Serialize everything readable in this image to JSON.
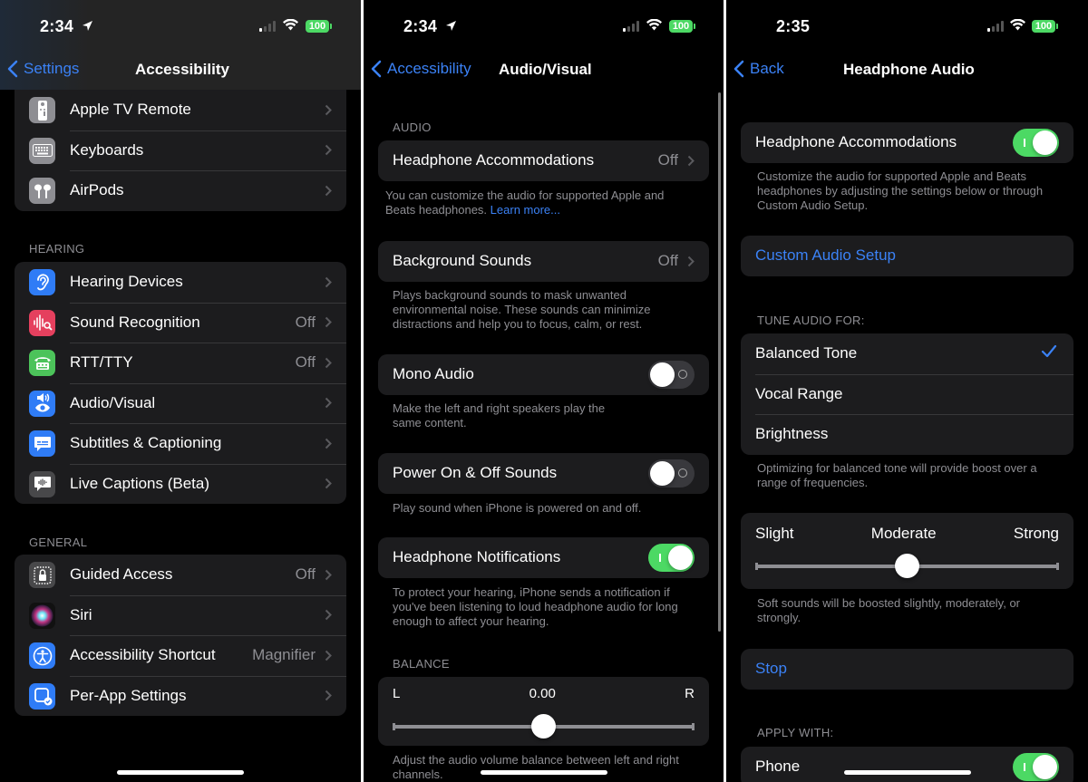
{
  "panels": [
    {
      "status": {
        "time": "2:34",
        "location_arrow": true,
        "battery": "100"
      },
      "nav": {
        "back_label": "Settings",
        "title": "Accessibility"
      },
      "groups": [
        {
          "header": "",
          "items": [
            {
              "label": "Apple TV Remote",
              "value": "",
              "icon": "apple-tv-remote-icon",
              "icon_color": "#8e8e93"
            },
            {
              "label": "Keyboards",
              "value": "",
              "icon": "keyboard-icon",
              "icon_color": "#8e8e93"
            },
            {
              "label": "AirPods",
              "value": "",
              "icon": "airpods-icon",
              "icon_color": "#8e8e93"
            }
          ]
        },
        {
          "header": "HEARING",
          "items": [
            {
              "label": "Hearing Devices",
              "value": "",
              "icon": "ear-icon",
              "icon_color": "#2f7cf6"
            },
            {
              "label": "Sound Recognition",
              "value": "Off",
              "icon": "sound-recognition-icon",
              "icon_color": "#e5405e"
            },
            {
              "label": "RTT/TTY",
              "value": "Off",
              "icon": "tty-phone-icon",
              "icon_color": "#4cc35a"
            },
            {
              "label": "Audio/Visual",
              "value": "",
              "icon": "audio-visual-icon",
              "icon_color": "#2f7cf6"
            },
            {
              "label": "Subtitles & Captioning",
              "value": "",
              "icon": "subtitles-icon",
              "icon_color": "#2f7cf6"
            },
            {
              "label": "Live Captions (Beta)",
              "value": "",
              "icon": "live-captions-icon",
              "icon_color": "#48484a"
            }
          ]
        },
        {
          "header": "GENERAL",
          "items": [
            {
              "label": "Guided Access",
              "value": "Off",
              "icon": "guided-access-lock-icon",
              "icon_color": "#48484a"
            },
            {
              "label": "Siri",
              "value": "",
              "icon": "siri-icon",
              "icon_color": "#222"
            },
            {
              "label": "Accessibility Shortcut",
              "value": "Magnifier",
              "icon": "accessibility-icon",
              "icon_color": "#2f7cf6"
            },
            {
              "label": "Per-App Settings",
              "value": "",
              "icon": "per-app-settings-icon",
              "icon_color": "#2f7cf6"
            }
          ]
        }
      ]
    },
    {
      "status": {
        "time": "2:34",
        "location_arrow": true,
        "battery": "100"
      },
      "nav": {
        "back_label": "Accessibility",
        "title": "Audio/Visual"
      },
      "audio_header": "AUDIO",
      "headphone_accommodations": {
        "label": "Headphone Accommodations",
        "value": "Off"
      },
      "headphone_accommodations_footer": "You can customize the audio for supported Apple and Beats headphones.",
      "learn_more": "Learn more...",
      "background_sounds": {
        "label": "Background Sounds",
        "value": "Off"
      },
      "background_sounds_footer": "Plays background sounds to mask unwanted environmental noise. These sounds can minimize distractions and help you to focus, calm, or rest.",
      "mono_audio": {
        "label": "Mono Audio",
        "on": false
      },
      "mono_audio_footer": "Make the left and right speakers play the same content.",
      "power_sounds": {
        "label": "Power On & Off Sounds",
        "on": false
      },
      "power_sounds_footer": "Play sound when iPhone is powered on and off.",
      "headphone_notifications": {
        "label": "Headphone Notifications",
        "on": true
      },
      "headphone_notifications_footer": "To protect your hearing, iPhone sends a notification if you've been listening to loud headphone audio for long enough to affect your hearing.",
      "balance_header": "BALANCE",
      "balance": {
        "left_label": "L",
        "right_label": "R",
        "value_text": "0.00",
        "value": 0.0,
        "min": -1,
        "max": 1
      },
      "balance_footer": "Adjust the audio volume balance between left and right channels."
    },
    {
      "status": {
        "time": "2:35",
        "location_arrow": false,
        "battery": "100"
      },
      "nav": {
        "back_label": "Back",
        "title": "Headphone Audio"
      },
      "headphone_accommodations": {
        "label": "Headphone Accommodations",
        "on": true
      },
      "headphone_accommodations_footer": "Customize the audio for supported Apple and Beats headphones by adjusting the settings below or through Custom Audio Setup.",
      "custom_audio_setup": "Custom Audio Setup",
      "tune_header": "TUNE AUDIO FOR:",
      "tune_options": [
        {
          "label": "Balanced Tone",
          "selected": true
        },
        {
          "label": "Vocal Range",
          "selected": false
        },
        {
          "label": "Brightness",
          "selected": false
        }
      ],
      "tune_footer": "Optimizing for balanced tone will provide boost over a range of frequencies.",
      "boost": {
        "labels": [
          "Slight",
          "Moderate",
          "Strong"
        ],
        "value": 0.5
      },
      "boost_footer": "Soft sounds will be boosted slightly, moderately, or strongly.",
      "stop_label": "Stop",
      "apply_header": "APPLY WITH:",
      "apply_phone": {
        "label": "Phone",
        "on": true
      }
    }
  ],
  "colors": {
    "accent": "#3b82f6",
    "toggle_on": "#4cd964",
    "group_bg": "#1c1c1e",
    "secondary_text": "#8e8e93"
  }
}
